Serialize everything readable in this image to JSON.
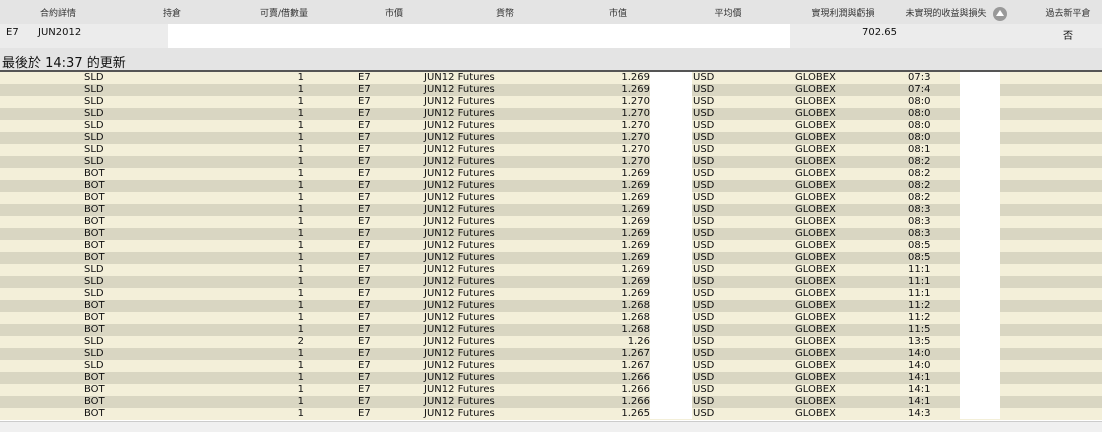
{
  "columns": [
    "合約詳情",
    "持倉",
    "可賣/借數量",
    "市價",
    "貨幣",
    "市值",
    "平均價",
    "實現利潤與虧損",
    "未實現的收益與損失",
    "過去新平倉"
  ],
  "summary": {
    "symbol": "E7",
    "expiry": "JUN2012",
    "realized_pnl": "702.65",
    "closed": "否"
  },
  "last_update": "最後於 14:37 的更新",
  "trades": [
    {
      "action": "SLD",
      "qty": "1",
      "symbol": "E7",
      "desc": "JUN12 Futures",
      "price": "1.269",
      "currency": "USD",
      "exchange": "GLOBEX",
      "time": "07:3"
    },
    {
      "action": "SLD",
      "qty": "1",
      "symbol": "E7",
      "desc": "JUN12 Futures",
      "price": "1.269",
      "currency": "USD",
      "exchange": "GLOBEX",
      "time": "07:4"
    },
    {
      "action": "SLD",
      "qty": "1",
      "symbol": "E7",
      "desc": "JUN12 Futures",
      "price": "1.270",
      "currency": "USD",
      "exchange": "GLOBEX",
      "time": "08:0"
    },
    {
      "action": "SLD",
      "qty": "1",
      "symbol": "E7",
      "desc": "JUN12 Futures",
      "price": "1.270",
      "currency": "USD",
      "exchange": "GLOBEX",
      "time": "08:0"
    },
    {
      "action": "SLD",
      "qty": "1",
      "symbol": "E7",
      "desc": "JUN12 Futures",
      "price": "1.270",
      "currency": "USD",
      "exchange": "GLOBEX",
      "time": "08:0"
    },
    {
      "action": "SLD",
      "qty": "1",
      "symbol": "E7",
      "desc": "JUN12 Futures",
      "price": "1.270",
      "currency": "USD",
      "exchange": "GLOBEX",
      "time": "08:0"
    },
    {
      "action": "SLD",
      "qty": "1",
      "symbol": "E7",
      "desc": "JUN12 Futures",
      "price": "1.270",
      "currency": "USD",
      "exchange": "GLOBEX",
      "time": "08:1"
    },
    {
      "action": "SLD",
      "qty": "1",
      "symbol": "E7",
      "desc": "JUN12 Futures",
      "price": "1.270",
      "currency": "USD",
      "exchange": "GLOBEX",
      "time": "08:2"
    },
    {
      "action": "BOT",
      "qty": "1",
      "symbol": "E7",
      "desc": "JUN12 Futures",
      "price": "1.269",
      "currency": "USD",
      "exchange": "GLOBEX",
      "time": "08:2"
    },
    {
      "action": "BOT",
      "qty": "1",
      "symbol": "E7",
      "desc": "JUN12 Futures",
      "price": "1.269",
      "currency": "USD",
      "exchange": "GLOBEX",
      "time": "08:2"
    },
    {
      "action": "BOT",
      "qty": "1",
      "symbol": "E7",
      "desc": "JUN12 Futures",
      "price": "1.269",
      "currency": "USD",
      "exchange": "GLOBEX",
      "time": "08:2"
    },
    {
      "action": "BOT",
      "qty": "1",
      "symbol": "E7",
      "desc": "JUN12 Futures",
      "price": "1.269",
      "currency": "USD",
      "exchange": "GLOBEX",
      "time": "08:3"
    },
    {
      "action": "BOT",
      "qty": "1",
      "symbol": "E7",
      "desc": "JUN12 Futures",
      "price": "1.269",
      "currency": "USD",
      "exchange": "GLOBEX",
      "time": "08:3"
    },
    {
      "action": "BOT",
      "qty": "1",
      "symbol": "E7",
      "desc": "JUN12 Futures",
      "price": "1.269",
      "currency": "USD",
      "exchange": "GLOBEX",
      "time": "08:3"
    },
    {
      "action": "BOT",
      "qty": "1",
      "symbol": "E7",
      "desc": "JUN12 Futures",
      "price": "1.269",
      "currency": "USD",
      "exchange": "GLOBEX",
      "time": "08:5"
    },
    {
      "action": "BOT",
      "qty": "1",
      "symbol": "E7",
      "desc": "JUN12 Futures",
      "price": "1.269",
      "currency": "USD",
      "exchange": "GLOBEX",
      "time": "08:5"
    },
    {
      "action": "SLD",
      "qty": "1",
      "symbol": "E7",
      "desc": "JUN12 Futures",
      "price": "1.269",
      "currency": "USD",
      "exchange": "GLOBEX",
      "time": "11:1"
    },
    {
      "action": "SLD",
      "qty": "1",
      "symbol": "E7",
      "desc": "JUN12 Futures",
      "price": "1.269",
      "currency": "USD",
      "exchange": "GLOBEX",
      "time": "11:1"
    },
    {
      "action": "SLD",
      "qty": "1",
      "symbol": "E7",
      "desc": "JUN12 Futures",
      "price": "1.269",
      "currency": "USD",
      "exchange": "GLOBEX",
      "time": "11:1"
    },
    {
      "action": "BOT",
      "qty": "1",
      "symbol": "E7",
      "desc": "JUN12 Futures",
      "price": "1.268",
      "currency": "USD",
      "exchange": "GLOBEX",
      "time": "11:2"
    },
    {
      "action": "BOT",
      "qty": "1",
      "symbol": "E7",
      "desc": "JUN12 Futures",
      "price": "1.268",
      "currency": "USD",
      "exchange": "GLOBEX",
      "time": "11:2"
    },
    {
      "action": "BOT",
      "qty": "1",
      "symbol": "E7",
      "desc": "JUN12 Futures",
      "price": "1.268",
      "currency": "USD",
      "exchange": "GLOBEX",
      "time": "11:5"
    },
    {
      "action": "SLD",
      "qty": "2",
      "symbol": "E7",
      "desc": "JUN12 Futures",
      "price": "1.26",
      "currency": "USD",
      "exchange": "GLOBEX",
      "time": "13:5"
    },
    {
      "action": "SLD",
      "qty": "1",
      "symbol": "E7",
      "desc": "JUN12 Futures",
      "price": "1.267",
      "currency": "USD",
      "exchange": "GLOBEX",
      "time": "14:0"
    },
    {
      "action": "SLD",
      "qty": "1",
      "symbol": "E7",
      "desc": "JUN12 Futures",
      "price": "1.267",
      "currency": "USD",
      "exchange": "GLOBEX",
      "time": "14:0"
    },
    {
      "action": "BOT",
      "qty": "1",
      "symbol": "E7",
      "desc": "JUN12 Futures",
      "price": "1.266",
      "currency": "USD",
      "exchange": "GLOBEX",
      "time": "14:1"
    },
    {
      "action": "BOT",
      "qty": "1",
      "symbol": "E7",
      "desc": "JUN12 Futures",
      "price": "1.266",
      "currency": "USD",
      "exchange": "GLOBEX",
      "time": "14:1"
    },
    {
      "action": "BOT",
      "qty": "1",
      "symbol": "E7",
      "desc": "JUN12 Futures",
      "price": "1.266",
      "currency": "USD",
      "exchange": "GLOBEX",
      "time": "14:1"
    },
    {
      "action": "BOT",
      "qty": "1",
      "symbol": "E7",
      "desc": "JUN12 Futures",
      "price": "1.265",
      "currency": "USD",
      "exchange": "GLOBEX",
      "time": "14:3"
    }
  ],
  "colors": {
    "row_light": "#f3efd9",
    "row_dark": "#d9d6c2",
    "header_bg": "#e4e4e4",
    "summary_bg": "#ececec"
  }
}
